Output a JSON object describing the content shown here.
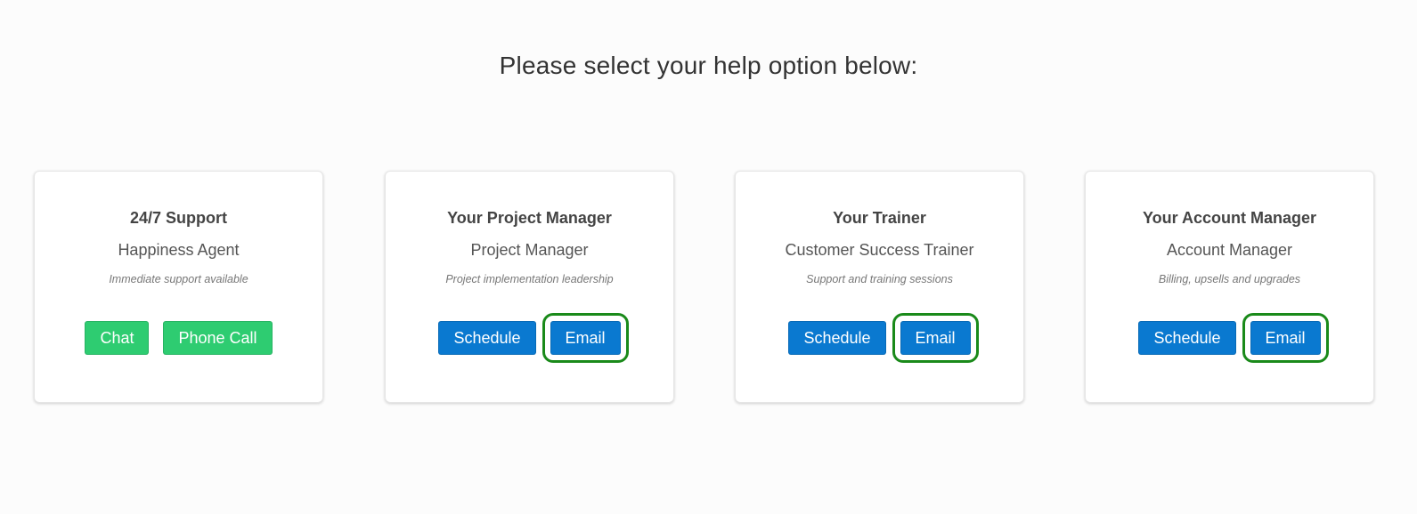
{
  "page": {
    "title": "Please select your help option below:"
  },
  "colors": {
    "green": "#2ecc71",
    "blue": "#0a79d0",
    "highlight": "#1a8a1a"
  },
  "cards": [
    {
      "title": "24/7 Support",
      "role": "Happiness Agent",
      "description": "Immediate support available",
      "buttons": [
        {
          "label": "Chat"
        },
        {
          "label": "Phone Call"
        }
      ]
    },
    {
      "title": "Your Project Manager",
      "role": "Project Manager",
      "description": "Project implementation leadership",
      "buttons": [
        {
          "label": "Schedule"
        },
        {
          "label": "Email",
          "highlighted": true
        }
      ]
    },
    {
      "title": "Your Trainer",
      "role": "Customer Success Trainer",
      "description": "Support and training sessions",
      "buttons": [
        {
          "label": "Schedule"
        },
        {
          "label": "Email",
          "highlighted": true
        }
      ]
    },
    {
      "title": "Your Account Manager",
      "role": "Account Manager",
      "description": "Billing, upsells and upgrades",
      "buttons": [
        {
          "label": "Schedule"
        },
        {
          "label": "Email",
          "highlighted": true
        }
      ]
    }
  ]
}
